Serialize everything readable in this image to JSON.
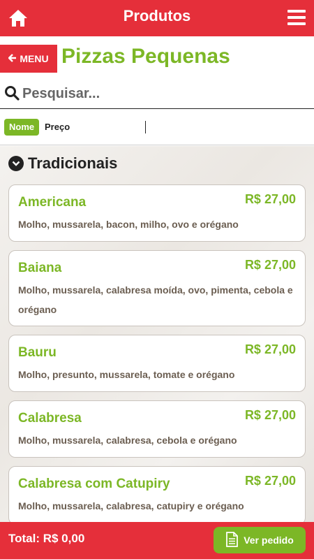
{
  "topbar": {
    "title": "Produtos",
    "home_icon": "home-icon",
    "menu_icon": "hamburger-icon"
  },
  "header": {
    "menu_label": "MENU",
    "page_title": "Pizzas Pequenas"
  },
  "search": {
    "placeholder": "Pesquisar..."
  },
  "sort": {
    "options": [
      "Nome",
      "Preço"
    ],
    "selected": "Nome"
  },
  "section": {
    "label": "Tradicionais"
  },
  "items": [
    {
      "name": "Americana",
      "price": "R$ 27,00",
      "desc": "Molho, mussarela, bacon, milho, ovo e orégano"
    },
    {
      "name": "Baiana",
      "price": "R$ 27,00",
      "desc": "Molho, mussarela, calabresa moída, ovo, pimenta, cebola e orégano"
    },
    {
      "name": "Bauru",
      "price": "R$ 27,00",
      "desc": "Molho, presunto, mussarela, tomate e orégano"
    },
    {
      "name": "Calabresa",
      "price": "R$ 27,00",
      "desc": "Molho, mussarela, calabresa, cebola e orégano"
    },
    {
      "name": "Calabresa com Catupiry",
      "price": "R$ 27,00",
      "desc": "Molho, mussarela, calabresa, catupiry e orégano"
    }
  ],
  "footer": {
    "total": "Total: R$ 0,00",
    "order_button": "Ver pedido"
  },
  "colors": {
    "red": "#e52f3a",
    "green": "#7cb726",
    "desc_brown": "#6b5e51"
  }
}
